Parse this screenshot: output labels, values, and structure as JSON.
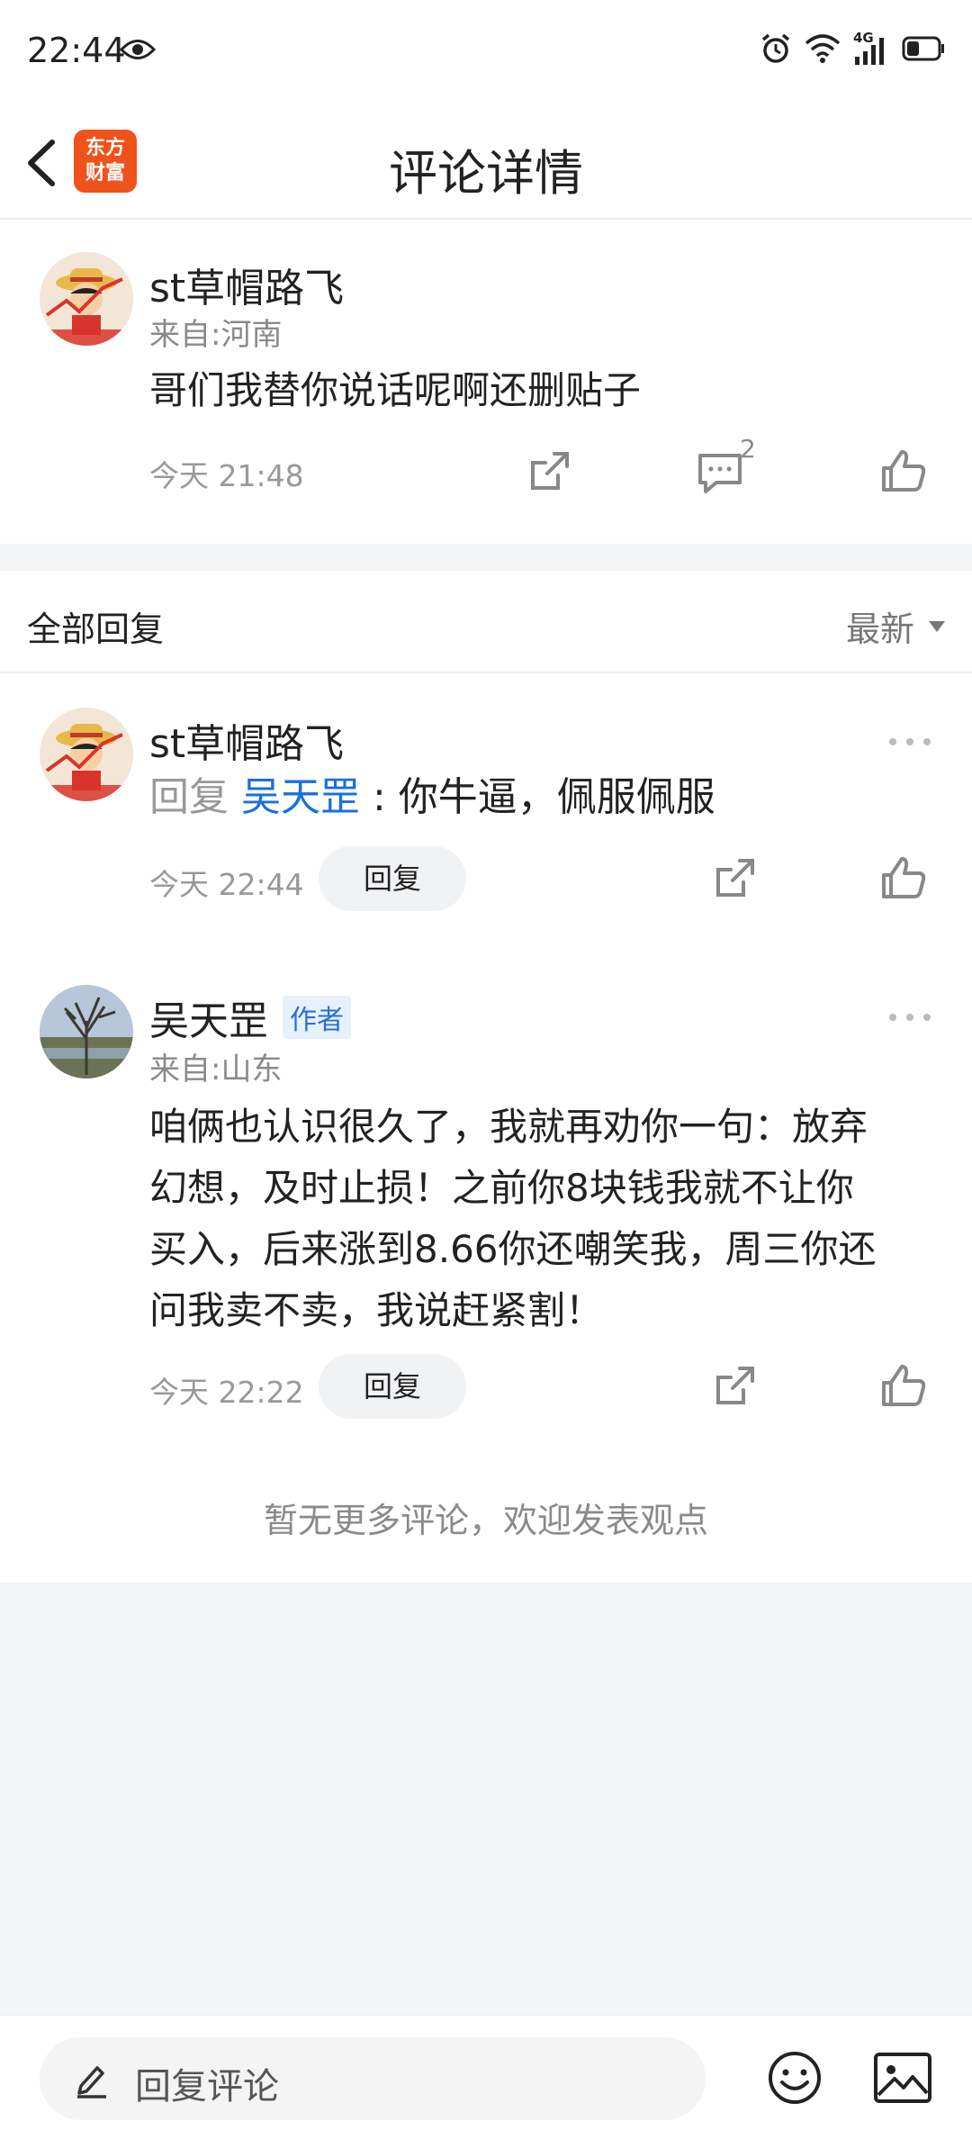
{
  "status_bar": {
    "time": "22:44",
    "network": "4G"
  },
  "header": {
    "title": "评论详情",
    "logo_text_line1": "东方",
    "logo_text_line2": "财富"
  },
  "post": {
    "username": "st草帽路飞",
    "location": "来自:河南",
    "content": "哥们我替你说话呢啊还删贴子",
    "time": "今天 21:48",
    "comment_count": "2"
  },
  "replies_section": {
    "title": "全部回复",
    "sort_label": "最新"
  },
  "replies": [
    {
      "username": "st草帽路飞",
      "reply_prefix": "回复",
      "mention": "吴天罡",
      "content": ": 你牛逼，佩服佩服",
      "time": "今天 22:44",
      "reply_button": "回复"
    },
    {
      "username": "吴天罡",
      "badge": "作者",
      "location": "来自:山东",
      "content_lines": [
        "咱俩也认识很久了，我就再劝你一句：放弃",
        "幻想，及时止损！之前你8块钱我就不让你",
        "买入，后来涨到8.66你还嘲笑我，周三你还",
        "问我卖不卖，我说赶紧割！"
      ],
      "time": "今天 22:22",
      "reply_button": "回复"
    }
  ],
  "footer_note": "暂无更多评论，欢迎发表观点",
  "bottom_bar": {
    "input_placeholder": "回复评论"
  },
  "colors": {
    "brand": "#f0521c",
    "mention": "#1a6fe0",
    "badge_bg": "#e7f1fc",
    "badge_text": "#2a6fd6"
  }
}
